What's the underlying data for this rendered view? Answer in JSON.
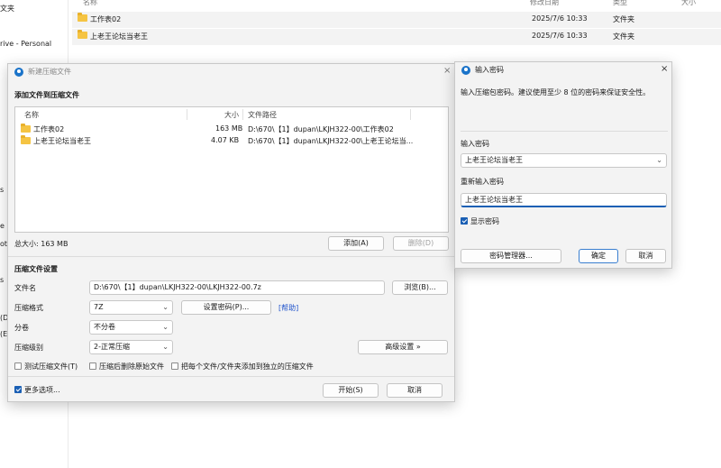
{
  "explorer": {
    "nav_items": [
      "文夹",
      "rive - Personal",
      "s",
      "e",
      "ot",
      "s",
      "(D",
      "(E"
    ],
    "columns": {
      "name": "名称",
      "modified": "修改日期",
      "type": "类型",
      "size": "大小"
    },
    "rows": [
      {
        "name": "工作表02",
        "modified": "2025/7/6 10:33",
        "type": "文件夹"
      },
      {
        "name": "上老王论坛当老王",
        "modified": "2025/7/6 10:33",
        "type": "文件夹"
      }
    ]
  },
  "archive_dialog": {
    "title": "新建压缩文件",
    "add_section": "添加文件到压缩文件",
    "list_headers": {
      "name": "名称",
      "size": "大小",
      "path": "文件路径"
    },
    "files": [
      {
        "name": "工作表02",
        "size": "163 MB",
        "path": "D:\\670\\【1】dupan\\LKJH322-00\\工作表02"
      },
      {
        "name": "上老王论坛当老王",
        "size": "4.07 KB",
        "path": "D:\\670\\【1】dupan\\LKJH322-00\\上老王论坛当..."
      }
    ],
    "total_size": "总大小: 163 MB",
    "add_button": "添加(A)",
    "delete_button": "删除(D)",
    "settings_section": "压缩文件设置",
    "filename_label": "文件名",
    "filename_value": "D:\\670\\【1】dupan\\LKJH322-00\\LKJH322-00.7z",
    "browse_button": "浏览(B)...",
    "format_label": "压缩格式",
    "format_value": "7Z",
    "set_password_button": "设置密码(P)...",
    "help_link": "[帮助]",
    "volume_label": "分卷",
    "volume_value": "不分卷",
    "level_label": "压缩级别",
    "level_value": "2-正常压缩",
    "advanced_button": "高级设置 »",
    "test_checkbox": "测试压缩文件(T)",
    "delete_after_checkbox": "压缩后删除原始文件",
    "separate_checkbox": "把每个文件/文件夹添加到独立的压缩文件",
    "more_options": "更多选项...",
    "start_button": "开始(S)",
    "cancel_button": "取消"
  },
  "password_dialog": {
    "title": "输入密码",
    "description": "输入压缩包密码。建议使用至少 8 位的密码来保证安全性。",
    "password_label": "输入密码",
    "password_value": "上老王论坛当老王",
    "confirm_label": "重新输入密码",
    "confirm_value": "上老王论坛当老王",
    "show_password": "显示密码",
    "manager_button": "密码管理器...",
    "ok_button": "确定",
    "cancel_button": "取消"
  },
  "colors": {
    "accent": "#1a5fb4",
    "folder": "#f5c443",
    "link": "#2255cc"
  }
}
